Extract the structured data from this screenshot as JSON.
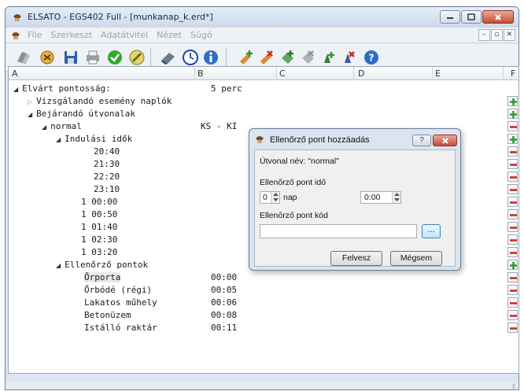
{
  "window": {
    "title": "ELSATO - EGS402 Full - [munkanap_k.erd*]"
  },
  "menu": {
    "items": [
      "File",
      "Szerkeszt",
      "Adatátvitel",
      "Nézet",
      "Súgó"
    ]
  },
  "toolbar": {
    "icons": [
      "open-icon",
      "settings-icon",
      "save-icon",
      "print-icon",
      "ok-icon",
      "tools-icon",
      "erase-icon",
      "clock-icon",
      "info-icon",
      "add-event-icon",
      "remove-event-icon",
      "add-route-icon",
      "remove-route-icon",
      "add-point-icon",
      "remove-point-icon",
      "help-icon"
    ]
  },
  "grid": {
    "columns": [
      "A",
      "B",
      "C",
      "D",
      "E",
      "F"
    ],
    "rows": [
      {
        "label": "Elvárt pontosság:",
        "value": "5 perc",
        "tri": "◢",
        "btn": ""
      },
      {
        "label": "Vizsgálandó esemény naplók",
        "value": "",
        "tri": "▷",
        "btn": "plus"
      },
      {
        "label": "Bejárandó útvonalak",
        "value": "",
        "tri": "◢",
        "btn": "plus"
      },
      {
        "label": "normal",
        "value": "KS - KI",
        "tri": "◢",
        "btn": "minus"
      },
      {
        "label": "Indulási idők",
        "value": "",
        "tri": "◢",
        "btn": "plus"
      },
      {
        "label": "20:40",
        "value": "",
        "tri": "",
        "btn": "minus"
      },
      {
        "label": "21:30",
        "value": "",
        "tri": "",
        "btn": "minus"
      },
      {
        "label": "22:20",
        "value": "",
        "tri": "",
        "btn": "minus"
      },
      {
        "label": "23:10",
        "value": "",
        "tri": "",
        "btn": "minus"
      },
      {
        "label": "1 00:00",
        "value": "",
        "tri": "",
        "btn": "minus"
      },
      {
        "label": "1 00:50",
        "value": "",
        "tri": "",
        "btn": "minus"
      },
      {
        "label": "1 01:40",
        "value": "",
        "tri": "",
        "btn": "minus"
      },
      {
        "label": "1 02:30",
        "value": "",
        "tri": "",
        "btn": "minus"
      },
      {
        "label": "1 03:20",
        "value": "",
        "tri": "",
        "btn": "minus"
      },
      {
        "label": "Ellenőrző pontok",
        "value": "",
        "tri": "◢",
        "btn": "plus"
      },
      {
        "label": "Őrporta",
        "value": "00:00",
        "tri": "",
        "btn": "minus",
        "selected": true
      },
      {
        "label": "Őrbódé (régi)",
        "value": "00:05",
        "tri": "",
        "btn": "minus"
      },
      {
        "label": "Lakatos műhely",
        "value": "00:06",
        "tri": "",
        "btn": "minus"
      },
      {
        "label": "Betonüzem",
        "value": "00:08",
        "tri": "",
        "btn": "minus"
      },
      {
        "label": "Istálló raktár",
        "value": "00:11",
        "tri": "",
        "btn": "minus"
      }
    ]
  },
  "dialog": {
    "title": "Ellenőrző pont hozzáadás",
    "help": "?",
    "route_name": "Útvonal név: \"normal\"",
    "time_label": "Ellenőrző pont idő",
    "day_value": "0",
    "day_unit": "nap",
    "time_value": "0:00",
    "code_label": "Ellenőrző pont kód",
    "code_value": "",
    "browse_label": "...",
    "ok_label": "Felvesz",
    "cancel_label": "Mégsem"
  },
  "colors": {
    "plus": "#2e9a2e",
    "minus": "#cc2a2a",
    "accent": "#3c7fb1"
  }
}
